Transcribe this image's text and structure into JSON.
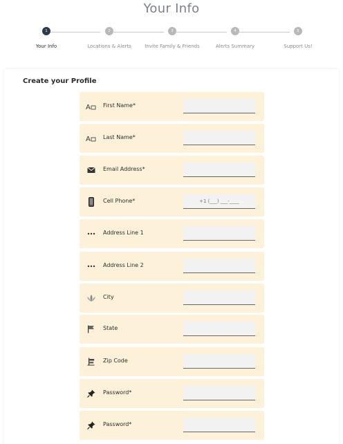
{
  "page": {
    "title": "Your Info"
  },
  "stepper": {
    "steps": [
      {
        "number": "1",
        "label": "Your Info",
        "active": true
      },
      {
        "number": "2",
        "label": "Locations & Alerts",
        "active": false
      },
      {
        "number": "3",
        "label": "Invite Family & Friends",
        "active": false
      },
      {
        "number": "4",
        "label": "Alerts Summary",
        "active": false
      },
      {
        "number": "5",
        "label": "Support Us!",
        "active": false
      }
    ]
  },
  "form": {
    "title": "Create your Profile",
    "fields": [
      {
        "label": "First Name*",
        "icon": "text-format-icon",
        "value": "",
        "placeholder": ""
      },
      {
        "label": "Last Name*",
        "icon": "text-format-icon",
        "value": "",
        "placeholder": ""
      },
      {
        "label": "Email Address*",
        "icon": "envelope-icon",
        "value": "",
        "placeholder": ""
      },
      {
        "label": "Cell Phone*",
        "icon": "phone-icon",
        "value": "",
        "placeholder": "+1 (___) ___-____"
      },
      {
        "label": "Address Line 1",
        "icon": "dots-icon",
        "value": "",
        "placeholder": ""
      },
      {
        "label": "Address Line 2",
        "icon": "dots-icon",
        "value": "",
        "placeholder": ""
      },
      {
        "label": "City",
        "icon": "lotus-icon",
        "value": "",
        "placeholder": ""
      },
      {
        "label": "State",
        "icon": "flag-icon",
        "value": "",
        "placeholder": ""
      },
      {
        "label": "Zip Code",
        "icon": "signpost-icon",
        "value": "",
        "placeholder": ""
      },
      {
        "label": "Password*",
        "icon": "pin-icon",
        "value": "",
        "placeholder": ""
      },
      {
        "label": "Password*",
        "icon": "pin-icon",
        "value": "",
        "placeholder": ""
      }
    ]
  }
}
